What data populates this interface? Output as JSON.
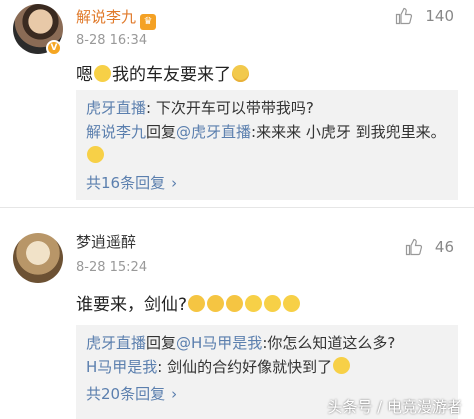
{
  "comments": [
    {
      "user": "解说李九",
      "time": "8-28 16:34",
      "likes": "140",
      "text_a": "嗯",
      "text_b": "我的车友要来了",
      "replies": [
        {
          "who": "虎牙直播",
          "text": ": 下次开车可以带带我吗?"
        },
        {
          "who": "解说李九",
          "mid": "回复",
          "target": "@虎牙直播",
          "text": ":来来来 小虎牙 到我兜里来。"
        }
      ],
      "more": "共16条回复"
    },
    {
      "user": "梦逍遥醉",
      "time": "8-28 15:24",
      "likes": "46",
      "text": "谁要来，剑仙?",
      "replies": [
        {
          "who": "虎牙直播",
          "mid": "回复",
          "target": "@H马甲是我",
          "text": ":你怎么知道这么多?"
        },
        {
          "who": "H马甲是我",
          "text": ": 剑仙的合约好像就快到了"
        }
      ],
      "more": "共20条回复"
    }
  ],
  "watermark": "头条号 / 电竞漫游者",
  "colors": {
    "link": "#5b7fae",
    "vip_name": "#e07a2b",
    "reply_bg": "#f2f2f2"
  }
}
